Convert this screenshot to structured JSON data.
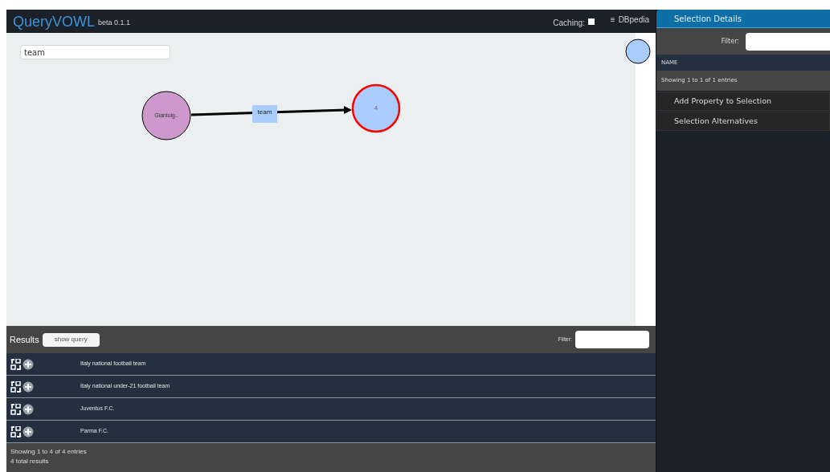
{
  "header": {
    "title": "QueryVOWL",
    "version": "beta 0.1.1",
    "caching_label": "Caching:",
    "caching_checked": false,
    "endpoint_icon": "≡",
    "endpoint": "DBpedia"
  },
  "graph": {
    "search_value": "team",
    "edge_label": "team",
    "nodes": [
      {
        "label": "Gianluig..",
        "kind": "instance",
        "selected": false
      },
      {
        "label": "4",
        "kind": "class",
        "selected": true
      }
    ]
  },
  "selection": {
    "title": "Selection Details",
    "filter_label": "Filter:",
    "column": "NAME",
    "info": "Showing 1 to 1 of 1 entries",
    "sections": [
      "Add Property to Selection",
      "Selection Alternatives"
    ]
  },
  "results": {
    "title": "Results",
    "show_query": "show query",
    "filter_label": "Filter:",
    "rows": [
      "Italy national football team",
      "Italy national under-21 football team",
      "Juventus F.C.",
      "Parma F.C."
    ],
    "info": "Showing 1 to 4 of 4 entries",
    "total": "4 total results"
  }
}
